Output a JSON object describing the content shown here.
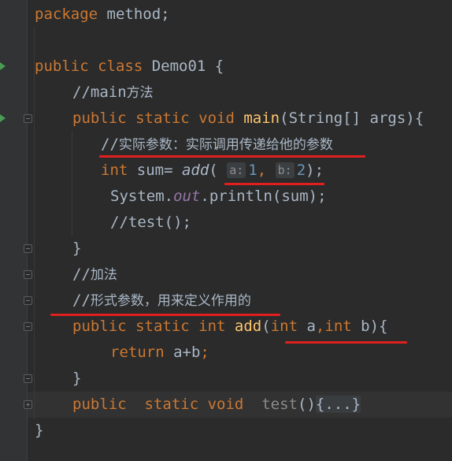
{
  "code": {
    "line1": {
      "kw": "package",
      "rest": " method;"
    },
    "line3": {
      "kw": "public class",
      "rest": " Demo01 {"
    },
    "line4": {
      "comment_prefix": "//main",
      "comment_zh": "方法"
    },
    "line5": {
      "kw": "public static void",
      "fn": "main",
      "rest": "(String[] args){"
    },
    "line6": {
      "comment_prefix": "//",
      "comment_zh": "实际参数：实际调用传递给他的参数"
    },
    "line7": {
      "kw": "int",
      "var": " sum= ",
      "call": "add",
      "open": "(",
      "hint_a": "a:",
      "arg1": "1",
      "comma": ",",
      "hint_b": "b:",
      "arg2": "2",
      "close": ");"
    },
    "line8": {
      "obj": "System.",
      "field": "out",
      "rest": ".println(sum);"
    },
    "line9": {
      "text": "//test();"
    },
    "line10": {
      "text": "}"
    },
    "line11": {
      "comment_prefix": "//",
      "comment_zh": "加法"
    },
    "line12": {
      "comment_prefix": "//",
      "comment_zh": "形式参数，用来定义作用的"
    },
    "line13": {
      "kw": "public static int",
      "fn": "add",
      "open": "(",
      "kw2": "int",
      "p1": " a",
      "comma": ",",
      "kw3": "int",
      "p2": " b",
      "close": "){"
    },
    "line14": {
      "kw": "return",
      "rest": " a+b",
      "semi": ";"
    },
    "line15": {
      "text": "}"
    },
    "line16": {
      "kw": "public  static void",
      "fn": "test",
      "parens": "()",
      "folded": "{...}"
    },
    "line17": {
      "text": "}"
    }
  },
  "colors": {
    "background": "#2b2b2b",
    "keyword": "#cc7832",
    "text": "#a9b7c6",
    "method": "#ffc66d",
    "number": "#6897bb",
    "static_field": "#9876aa",
    "annotation_underline": "#e01f1f",
    "run_marker": "#499c54"
  }
}
